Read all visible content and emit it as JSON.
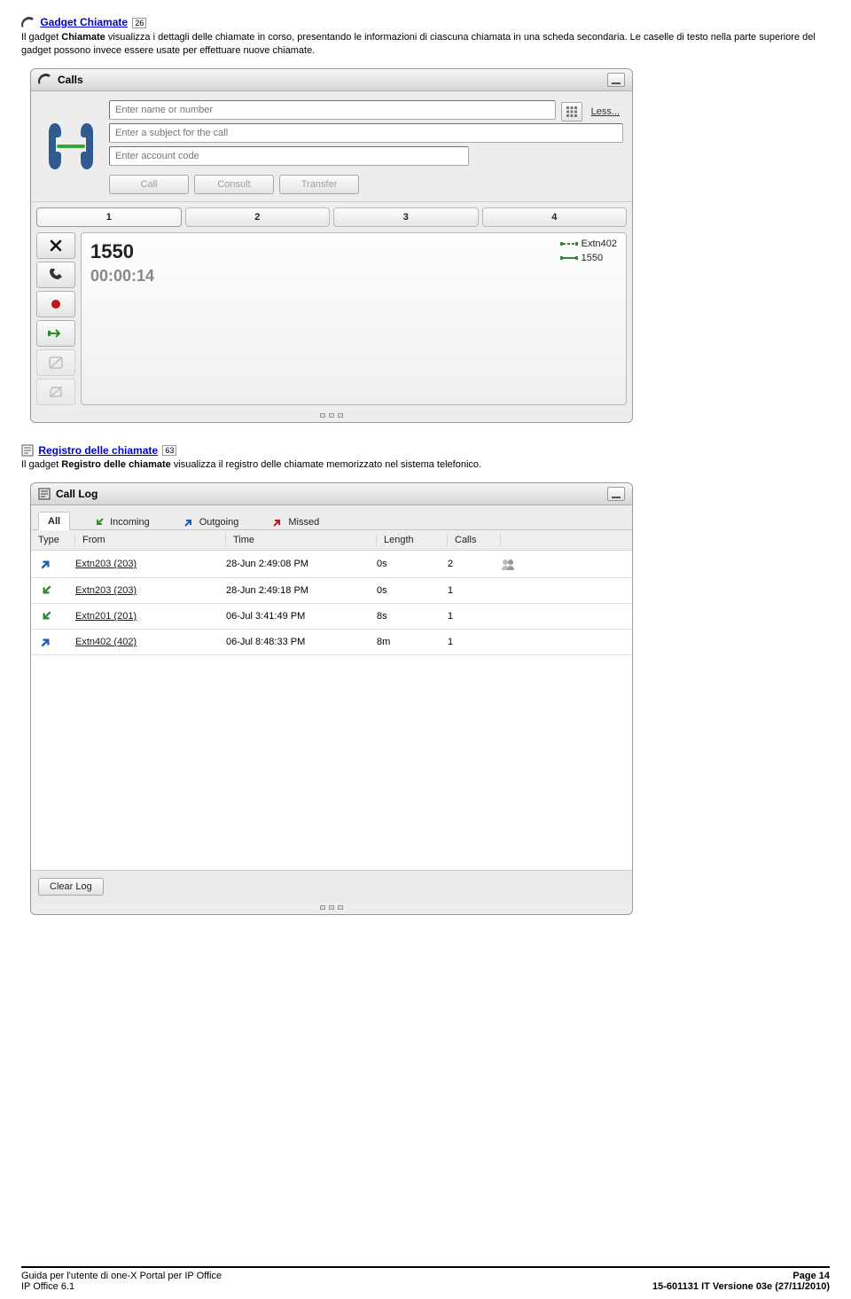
{
  "section1": {
    "title_link": "Gadget Chiamate",
    "pageref": "26",
    "para1_prefix": "Il gadget ",
    "para1_bold": "Chiamate",
    "para1_rest": " visualizza i dettagli delle chiamate in corso, presentando le informazioni di ciascuna chiamata in una scheda secondaria. Le caselle di testo nella parte superiore del gadget possono invece essere usate per effettuare nuove chiamate."
  },
  "calls_gadget": {
    "title": "Calls",
    "inputs": {
      "name_placeholder": "Enter name or number",
      "subject_placeholder": "Enter a subject for the call",
      "account_placeholder": "Enter account code",
      "less_label": "Less..."
    },
    "buttons": {
      "call": "Call",
      "consult": "Consult",
      "transfer": "Transfer"
    },
    "tabs": [
      "1",
      "2",
      "3",
      "4"
    ],
    "active_call": {
      "number": "1550",
      "timer": "00:00:14"
    },
    "side_calls": [
      {
        "label": "Extn402",
        "color": "#2e8b2e"
      },
      {
        "label": "1550",
        "color": "#2e8b2e"
      }
    ]
  },
  "section2": {
    "title_link": "Registro delle chiamate",
    "pageref": "63",
    "para_prefix": "Il gadget ",
    "para_bold": "Registro delle chiamate",
    "para_rest": " visualizza il registro delle chiamate memorizzato nel sistema telefonico."
  },
  "log_gadget": {
    "title": "Call Log",
    "tabs": {
      "all": "All",
      "incoming": "Incoming",
      "outgoing": "Outgoing",
      "missed": "Missed"
    },
    "columns": {
      "type": "Type",
      "from": "From",
      "time": "Time",
      "length": "Length",
      "calls": "Calls"
    },
    "rows": [
      {
        "dir": "out",
        "from": "Extn203 (203)",
        "time": "28-Jun 2:49:08 PM",
        "length": "0s",
        "calls": "2",
        "action_icon": true
      },
      {
        "dir": "in",
        "from": "Extn203 (203)",
        "time": "28-Jun 2:49:18 PM",
        "length": "0s",
        "calls": "1",
        "action_icon": false
      },
      {
        "dir": "in",
        "from": "Extn201 (201)",
        "time": "06-Jul 3:41:49 PM",
        "length": "8s",
        "calls": "1",
        "action_icon": false
      },
      {
        "dir": "out",
        "from": "Extn402 (402)",
        "time": "06-Jul 8:48:33 PM",
        "length": "8m",
        "calls": "1",
        "action_icon": false
      }
    ],
    "clear_label": "Clear Log"
  },
  "footer": {
    "left1": "Guida per l'utente di one-X Portal per IP Office",
    "left2": "IP Office 6.1",
    "right1": "Page 14",
    "right2": "15-601131 IT Versione 03e (27/11/2010)"
  }
}
